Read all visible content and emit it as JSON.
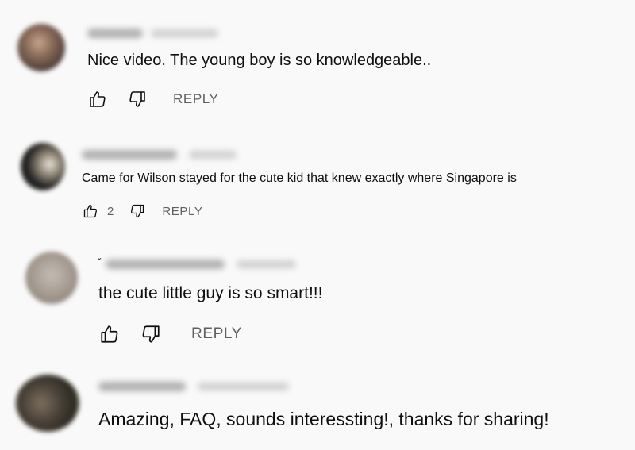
{
  "comments": [
    {
      "text": "Nice video. The young boy is so knowledgeable..",
      "like_count": "",
      "reply_label": "REPLY",
      "author_blurred": true,
      "avatar_color": "#7a6a60"
    },
    {
      "text": "Came for Wilson stayed for the cute kid that knew exactly where Singapore is",
      "like_count": "2",
      "reply_label": "REPLY",
      "author_blurred": true,
      "avatar_color": "#2b2b2b"
    },
    {
      "text": "the cute little guy is so smart!!!",
      "like_count": "",
      "reply_label": "REPLY",
      "author_blurred": true,
      "avatar_color": "#a8a098"
    },
    {
      "text": "Amazing,  FAQ, sounds interessting!, thanks for sharing!",
      "like_count": "",
      "reply_label": "",
      "author_blurred": true,
      "avatar_color": "#4a4a40"
    }
  ],
  "icons": {
    "like": "thumbs-up-icon",
    "dislike": "thumbs-down-icon"
  },
  "colors": {
    "background": "#f9f9f9",
    "text": "#0f0f0f",
    "secondary": "#606060"
  }
}
